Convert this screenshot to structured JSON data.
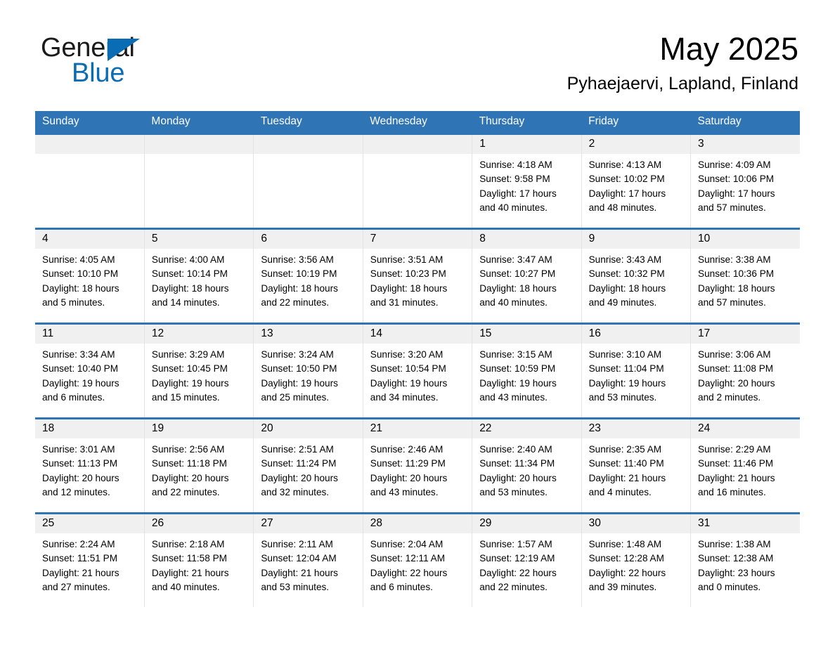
{
  "logo": {
    "line1": "General",
    "line2": "Blue",
    "triangle_color": "#0a6cb4",
    "icon": "triangle-logo-icon"
  },
  "header": {
    "month_title": "May 2025",
    "location": "Pyhaejaervi, Lapland, Finland"
  },
  "theme": {
    "header_blue": "#2f74b5",
    "daynum_gray": "#f0f0f0",
    "cell_border": "#e3e3e3"
  },
  "calendar": {
    "weekday_headers": [
      "Sunday",
      "Monday",
      "Tuesday",
      "Wednesday",
      "Thursday",
      "Friday",
      "Saturday"
    ],
    "weeks": [
      [
        {
          "day": "",
          "sunrise": "",
          "sunset": "",
          "daylight": ""
        },
        {
          "day": "",
          "sunrise": "",
          "sunset": "",
          "daylight": ""
        },
        {
          "day": "",
          "sunrise": "",
          "sunset": "",
          "daylight": ""
        },
        {
          "day": "",
          "sunrise": "",
          "sunset": "",
          "daylight": ""
        },
        {
          "day": "1",
          "sunrise": "Sunrise: 4:18 AM",
          "sunset": "Sunset: 9:58 PM",
          "daylight": "Daylight: 17 hours and 40 minutes."
        },
        {
          "day": "2",
          "sunrise": "Sunrise: 4:13 AM",
          "sunset": "Sunset: 10:02 PM",
          "daylight": "Daylight: 17 hours and 48 minutes."
        },
        {
          "day": "3",
          "sunrise": "Sunrise: 4:09 AM",
          "sunset": "Sunset: 10:06 PM",
          "daylight": "Daylight: 17 hours and 57 minutes."
        }
      ],
      [
        {
          "day": "4",
          "sunrise": "Sunrise: 4:05 AM",
          "sunset": "Sunset: 10:10 PM",
          "daylight": "Daylight: 18 hours and 5 minutes."
        },
        {
          "day": "5",
          "sunrise": "Sunrise: 4:00 AM",
          "sunset": "Sunset: 10:14 PM",
          "daylight": "Daylight: 18 hours and 14 minutes."
        },
        {
          "day": "6",
          "sunrise": "Sunrise: 3:56 AM",
          "sunset": "Sunset: 10:19 PM",
          "daylight": "Daylight: 18 hours and 22 minutes."
        },
        {
          "day": "7",
          "sunrise": "Sunrise: 3:51 AM",
          "sunset": "Sunset: 10:23 PM",
          "daylight": "Daylight: 18 hours and 31 minutes."
        },
        {
          "day": "8",
          "sunrise": "Sunrise: 3:47 AM",
          "sunset": "Sunset: 10:27 PM",
          "daylight": "Daylight: 18 hours and 40 minutes."
        },
        {
          "day": "9",
          "sunrise": "Sunrise: 3:43 AM",
          "sunset": "Sunset: 10:32 PM",
          "daylight": "Daylight: 18 hours and 49 minutes."
        },
        {
          "day": "10",
          "sunrise": "Sunrise: 3:38 AM",
          "sunset": "Sunset: 10:36 PM",
          "daylight": "Daylight: 18 hours and 57 minutes."
        }
      ],
      [
        {
          "day": "11",
          "sunrise": "Sunrise: 3:34 AM",
          "sunset": "Sunset: 10:40 PM",
          "daylight": "Daylight: 19 hours and 6 minutes."
        },
        {
          "day": "12",
          "sunrise": "Sunrise: 3:29 AM",
          "sunset": "Sunset: 10:45 PM",
          "daylight": "Daylight: 19 hours and 15 minutes."
        },
        {
          "day": "13",
          "sunrise": "Sunrise: 3:24 AM",
          "sunset": "Sunset: 10:50 PM",
          "daylight": "Daylight: 19 hours and 25 minutes."
        },
        {
          "day": "14",
          "sunrise": "Sunrise: 3:20 AM",
          "sunset": "Sunset: 10:54 PM",
          "daylight": "Daylight: 19 hours and 34 minutes."
        },
        {
          "day": "15",
          "sunrise": "Sunrise: 3:15 AM",
          "sunset": "Sunset: 10:59 PM",
          "daylight": "Daylight: 19 hours and 43 minutes."
        },
        {
          "day": "16",
          "sunrise": "Sunrise: 3:10 AM",
          "sunset": "Sunset: 11:04 PM",
          "daylight": "Daylight: 19 hours and 53 minutes."
        },
        {
          "day": "17",
          "sunrise": "Sunrise: 3:06 AM",
          "sunset": "Sunset: 11:08 PM",
          "daylight": "Daylight: 20 hours and 2 minutes."
        }
      ],
      [
        {
          "day": "18",
          "sunrise": "Sunrise: 3:01 AM",
          "sunset": "Sunset: 11:13 PM",
          "daylight": "Daylight: 20 hours and 12 minutes."
        },
        {
          "day": "19",
          "sunrise": "Sunrise: 2:56 AM",
          "sunset": "Sunset: 11:18 PM",
          "daylight": "Daylight: 20 hours and 22 minutes."
        },
        {
          "day": "20",
          "sunrise": "Sunrise: 2:51 AM",
          "sunset": "Sunset: 11:24 PM",
          "daylight": "Daylight: 20 hours and 32 minutes."
        },
        {
          "day": "21",
          "sunrise": "Sunrise: 2:46 AM",
          "sunset": "Sunset: 11:29 PM",
          "daylight": "Daylight: 20 hours and 43 minutes."
        },
        {
          "day": "22",
          "sunrise": "Sunrise: 2:40 AM",
          "sunset": "Sunset: 11:34 PM",
          "daylight": "Daylight: 20 hours and 53 minutes."
        },
        {
          "day": "23",
          "sunrise": "Sunrise: 2:35 AM",
          "sunset": "Sunset: 11:40 PM",
          "daylight": "Daylight: 21 hours and 4 minutes."
        },
        {
          "day": "24",
          "sunrise": "Sunrise: 2:29 AM",
          "sunset": "Sunset: 11:46 PM",
          "daylight": "Daylight: 21 hours and 16 minutes."
        }
      ],
      [
        {
          "day": "25",
          "sunrise": "Sunrise: 2:24 AM",
          "sunset": "Sunset: 11:51 PM",
          "daylight": "Daylight: 21 hours and 27 minutes."
        },
        {
          "day": "26",
          "sunrise": "Sunrise: 2:18 AM",
          "sunset": "Sunset: 11:58 PM",
          "daylight": "Daylight: 21 hours and 40 minutes."
        },
        {
          "day": "27",
          "sunrise": "Sunrise: 2:11 AM",
          "sunset": "Sunset: 12:04 AM",
          "daylight": "Daylight: 21 hours and 53 minutes."
        },
        {
          "day": "28",
          "sunrise": "Sunrise: 2:04 AM",
          "sunset": "Sunset: 12:11 AM",
          "daylight": "Daylight: 22 hours and 6 minutes."
        },
        {
          "day": "29",
          "sunrise": "Sunrise: 1:57 AM",
          "sunset": "Sunset: 12:19 AM",
          "daylight": "Daylight: 22 hours and 22 minutes."
        },
        {
          "day": "30",
          "sunrise": "Sunrise: 1:48 AM",
          "sunset": "Sunset: 12:28 AM",
          "daylight": "Daylight: 22 hours and 39 minutes."
        },
        {
          "day": "31",
          "sunrise": "Sunrise: 1:38 AM",
          "sunset": "Sunset: 12:38 AM",
          "daylight": "Daylight: 23 hours and 0 minutes."
        }
      ]
    ]
  }
}
